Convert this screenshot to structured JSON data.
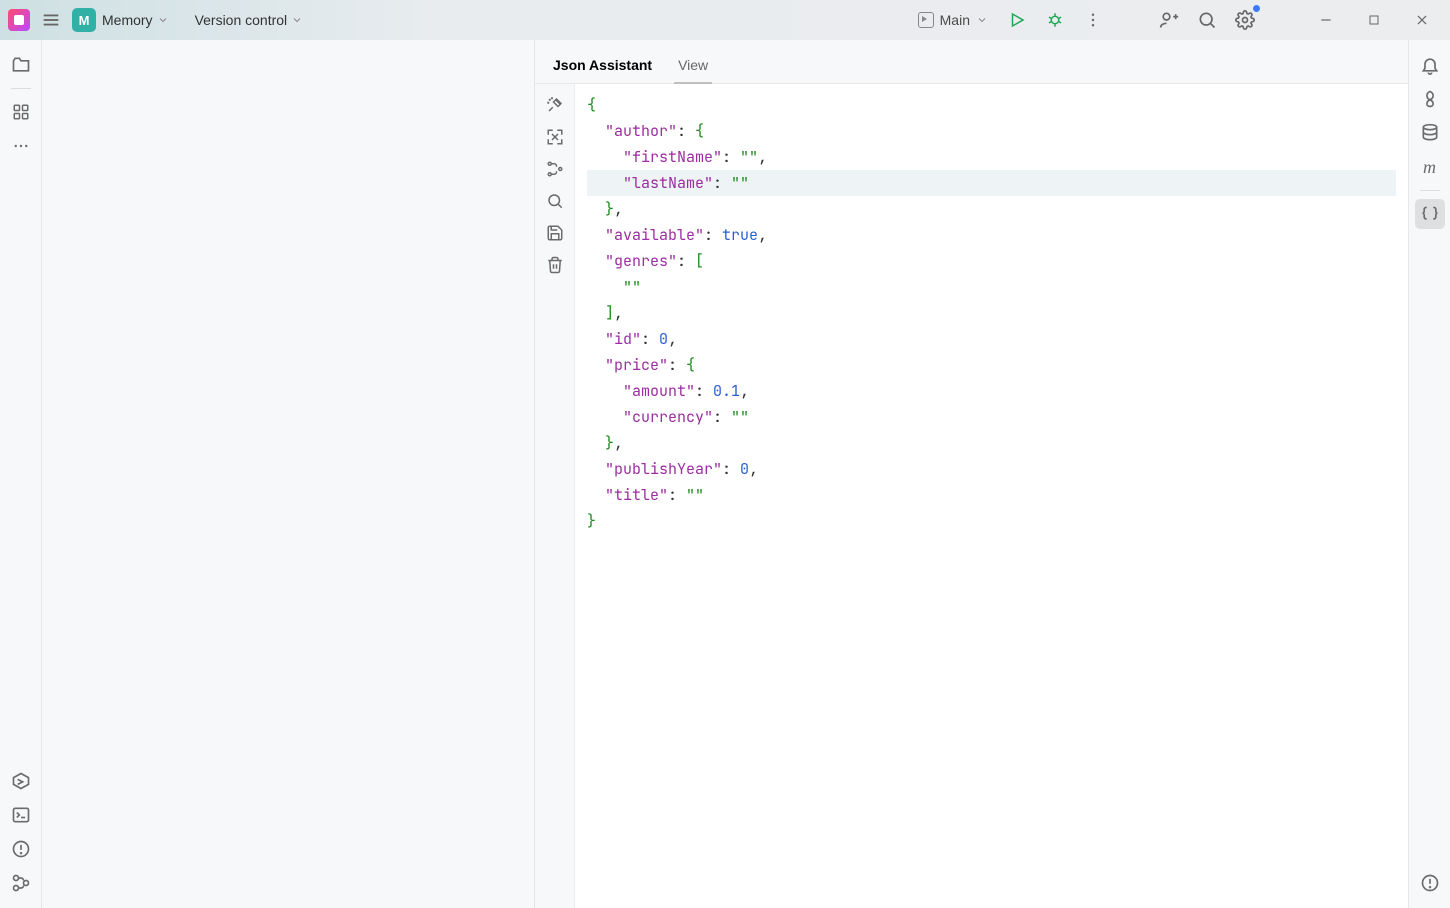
{
  "topbar": {
    "project_initial": "M",
    "project_name": "Memory",
    "vcs_label": "Version control",
    "run_config": "Main"
  },
  "panel": {
    "tabs": {
      "json": "Json Assistant",
      "view": "View"
    }
  },
  "json_lines": [
    [
      {
        "t": "{",
        "c": "brace"
      }
    ],
    [
      {
        "t": "  "
      },
      {
        "t": "\"author\"",
        "c": "key"
      },
      {
        "t": ": ",
        "c": "punct"
      },
      {
        "t": "{",
        "c": "brace"
      }
    ],
    [
      {
        "t": "    "
      },
      {
        "t": "\"firstName\"",
        "c": "key"
      },
      {
        "t": ": ",
        "c": "punct"
      },
      {
        "t": "\"\"",
        "c": "str"
      },
      {
        "t": ",",
        "c": "punct"
      }
    ],
    [
      {
        "t": "    ",
        "hl": true
      },
      {
        "t": "\"lastName\"",
        "c": "key"
      },
      {
        "t": ": ",
        "c": "punct"
      },
      {
        "t": "\"\"",
        "c": "str"
      }
    ],
    [
      {
        "t": "  "
      },
      {
        "t": "}",
        "c": "brace"
      },
      {
        "t": ",",
        "c": "punct"
      }
    ],
    [
      {
        "t": "  "
      },
      {
        "t": "\"available\"",
        "c": "key"
      },
      {
        "t": ": ",
        "c": "punct"
      },
      {
        "t": "true",
        "c": "bool"
      },
      {
        "t": ",",
        "c": "punct"
      }
    ],
    [
      {
        "t": "  "
      },
      {
        "t": "\"genres\"",
        "c": "key"
      },
      {
        "t": ": ",
        "c": "punct"
      },
      {
        "t": "[",
        "c": "brace"
      }
    ],
    [
      {
        "t": "    "
      },
      {
        "t": "\"\"",
        "c": "str"
      }
    ],
    [
      {
        "t": "  "
      },
      {
        "t": "]",
        "c": "brace"
      },
      {
        "t": ",",
        "c": "punct"
      }
    ],
    [
      {
        "t": "  "
      },
      {
        "t": "\"id\"",
        "c": "key"
      },
      {
        "t": ": ",
        "c": "punct"
      },
      {
        "t": "0",
        "c": "num"
      },
      {
        "t": ",",
        "c": "punct"
      }
    ],
    [
      {
        "t": "  "
      },
      {
        "t": "\"price\"",
        "c": "key"
      },
      {
        "t": ": ",
        "c": "punct"
      },
      {
        "t": "{",
        "c": "brace"
      }
    ],
    [
      {
        "t": "    "
      },
      {
        "t": "\"amount\"",
        "c": "key"
      },
      {
        "t": ": ",
        "c": "punct"
      },
      {
        "t": "0.1",
        "c": "num"
      },
      {
        "t": ",",
        "c": "punct"
      }
    ],
    [
      {
        "t": "    "
      },
      {
        "t": "\"currency\"",
        "c": "key"
      },
      {
        "t": ": ",
        "c": "punct"
      },
      {
        "t": "\"\"",
        "c": "str"
      }
    ],
    [
      {
        "t": "  "
      },
      {
        "t": "}",
        "c": "brace"
      },
      {
        "t": ",",
        "c": "punct"
      }
    ],
    [
      {
        "t": "  "
      },
      {
        "t": "\"publishYear\"",
        "c": "key"
      },
      {
        "t": ": ",
        "c": "punct"
      },
      {
        "t": "0",
        "c": "num"
      },
      {
        "t": ",",
        "c": "punct"
      }
    ],
    [
      {
        "t": "  "
      },
      {
        "t": "\"title\"",
        "c": "key"
      },
      {
        "t": ": ",
        "c": "punct"
      },
      {
        "t": "\"\"",
        "c": "str"
      }
    ],
    [
      {
        "t": "}",
        "c": "brace"
      }
    ]
  ]
}
